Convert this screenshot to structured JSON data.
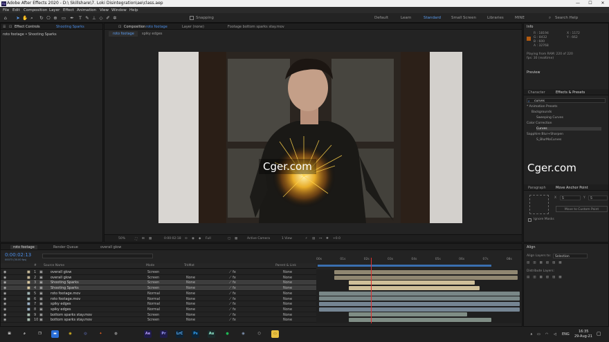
{
  "window": {
    "title": "Adobe After Effects 2020 - D:\\ Skillshare\\7. Loki Disintegration\\ae\\class.aep",
    "app_badge": "Ae",
    "minimize": "—",
    "maximize": "☐",
    "close": "✕"
  },
  "menu": [
    "File",
    "Edit",
    "Composition",
    "Layer",
    "Effect",
    "Animation",
    "View",
    "Window",
    "Help"
  ],
  "toolbar": {
    "snapping": "Snapping",
    "workspaces": [
      "Default",
      "Learn",
      "Standard",
      "Small Screen",
      "Libraries",
      "MINE"
    ],
    "active_workspace": "Standard",
    "search_help": "Search Help"
  },
  "effect_controls": {
    "tab": "Effect Controls",
    "tab_layer": "Shooting Sparks",
    "breadcrumb": "roto footage • Shooting Sparks"
  },
  "composition": {
    "tab": "Composition",
    "tab_comp": "roto footage",
    "layer_tab": "Layer  (none)",
    "footage_tab": "Footage  bottom sparks stay.mov",
    "view_tabs": [
      "roto footage",
      "spiky edges"
    ],
    "zoom": "50%",
    "timecode": "0:00:02:18",
    "resolution": "Full",
    "camera": "Active Camera",
    "views": "1 View",
    "exposure": "+0.0",
    "watermark": "Cger.com"
  },
  "info": {
    "title": "Info",
    "r": "R :  18194",
    "g": "G :  8432",
    "b": "B :  600",
    "a": "A :  32768",
    "x": "X :  1172",
    "y": "Y :  662",
    "playing": "Playing from RAM: 220 of 220",
    "fps": "fps: 30 (realtime)",
    "swatch": "#b25a10"
  },
  "preview": {
    "title": "Preview"
  },
  "effects": {
    "tab_character": "Character",
    "tab_effects": "Effects & Presets",
    "search": "curves",
    "tree": [
      {
        "label": "* Animation Presets",
        "indent": 0
      },
      {
        "label": "Backgrounds",
        "indent": 1
      },
      {
        "label": "Sweeping Curves",
        "indent": 2
      },
      {
        "label": "Color Correction",
        "indent": 0
      },
      {
        "label": "Curves",
        "indent": 2,
        "selected": true
      },
      {
        "label": "Sapphire Blur+Sharpen",
        "indent": 0
      },
      {
        "label": "S_BlurMoCurves",
        "indent": 2
      }
    ]
  },
  "paragraph": {
    "tab": "Paragraph",
    "tab_anchor": "Move Anchor Point",
    "x_label": "X",
    "x_value": "5",
    "y_label": "Y",
    "y_value": "5",
    "move_button": "Move to Custom Point",
    "ignore_masks": "Ignore Masks"
  },
  "align": {
    "title": "Align",
    "align_to_label": "Align Layers to:",
    "align_to_value": "Selection",
    "distribute": "Distribute Layers:"
  },
  "timeline": {
    "tabs": [
      "roto footage",
      "Render Queue",
      "overall glow"
    ],
    "timecode": "0:00:02:13",
    "frame_info": "00073 (30.00 fps)",
    "headers": {
      "num": "#",
      "name": "Source Name",
      "mode": "Mode",
      "trkmat": "TrkMat",
      "parent": "Parent & Link"
    },
    "ruler": [
      "00s",
      "01s",
      "02s",
      "03s",
      "04s",
      "05s",
      "06s",
      "07s",
      "08s"
    ],
    "playhead_seconds": 2.23,
    "duration_seconds": 8.5,
    "layers": [
      {
        "num": "1",
        "name": "overall glow",
        "mode": "Screen",
        "trkmat": "",
        "parent": "None",
        "color": "#c1b494",
        "start": 0.7,
        "end": 8.4,
        "sel": false
      },
      {
        "num": "2",
        "name": "overall glow",
        "mode": "Screen",
        "trkmat": "None",
        "parent": "None",
        "color": "#c1b494",
        "start": 0.7,
        "end": 8.4,
        "sel": false
      },
      {
        "num": "3",
        "name": "Shooting Sparks",
        "mode": "Screen",
        "trkmat": "None",
        "parent": "None",
        "color": "#d8c8a0",
        "start": 1.3,
        "end": 6.6,
        "sel": true
      },
      {
        "num": "4",
        "name": "Shooting Sparks",
        "mode": "Screen",
        "trkmat": "None",
        "parent": "None",
        "color": "#d8c8a0",
        "start": 1.3,
        "end": 6.8,
        "sel": true
      },
      {
        "num": "5",
        "name": "roto footage.mov",
        "mode": "Normal",
        "trkmat": "None",
        "parent": "None",
        "color": "#a0b4b4",
        "start": 0.05,
        "end": 8.5,
        "sel": false
      },
      {
        "num": "6",
        "name": "roto footage.mov",
        "mode": "Normal",
        "trkmat": "None",
        "parent": "None",
        "color": "#a0b4b4",
        "start": 0.05,
        "end": 8.5,
        "sel": false
      },
      {
        "num": "7",
        "name": "spiky edges",
        "mode": "Normal",
        "trkmat": "None",
        "parent": "None",
        "color": "#9ab0c4",
        "start": 0.05,
        "end": 8.5,
        "sel": false
      },
      {
        "num": "8",
        "name": "spiky edges",
        "mode": "Normal",
        "trkmat": "None",
        "parent": "None",
        "color": "#9ab0c4",
        "start": 0.05,
        "end": 8.5,
        "sel": false
      },
      {
        "num": "9",
        "name": "bottom sparks stay.mov",
        "mode": "Screen",
        "trkmat": "None",
        "parent": "None",
        "color": "#a8bcb0",
        "start": 1.3,
        "end": 6.3,
        "sel": false
      },
      {
        "num": "10",
        "name": "bottom sparks stay.mov",
        "mode": "Screen",
        "trkmat": "None",
        "parent": "None",
        "color": "#a8bcb0",
        "start": 1.3,
        "end": 7.3,
        "sel": false
      }
    ]
  },
  "taskbar": {
    "lang": "ENG",
    "time": "16:35",
    "date": "29-Aug-21",
    "icons": [
      {
        "name": "windows-icon",
        "glyph": "⊞",
        "bg": "transparent",
        "fg": "#ffffff"
      },
      {
        "name": "search-icon",
        "glyph": "⌕",
        "bg": "transparent",
        "fg": "#ffffff"
      },
      {
        "name": "task-view-icon",
        "glyph": "❐",
        "bg": "transparent",
        "fg": "#ffffff"
      },
      {
        "name": "file-explorer-icon",
        "glyph": "▬",
        "bg": "#2b6fd8",
        "fg": "#ffffff"
      },
      {
        "name": "chrome-icon",
        "glyph": "◉",
        "bg": "transparent",
        "fg": "#e8c020"
      },
      {
        "name": "browser-icon",
        "glyph": "◎",
        "bg": "transparent",
        "fg": "#6a7fd8"
      },
      {
        "name": "app-icon",
        "glyph": "✦",
        "bg": "transparent",
        "fg": "#e86020"
      },
      {
        "name": "media-icon",
        "glyph": "◍",
        "bg": "transparent",
        "fg": "#d0d0d0"
      },
      {
        "name": "after-effects-icon",
        "glyph": "Ae",
        "bg": "#1f1b4a",
        "fg": "#b79cff"
      },
      {
        "name": "premiere-icon",
        "glyph": "Pr",
        "bg": "#1f1b4a",
        "fg": "#9f9fff"
      },
      {
        "name": "lightroom-icon",
        "glyph": "LrC",
        "bg": "#0d2437",
        "fg": "#5fb5ff"
      },
      {
        "name": "photoshop-icon",
        "glyph": "Ps",
        "bg": "#0d2437",
        "fg": "#31a8ff"
      },
      {
        "name": "audition-icon",
        "glyph": "Au",
        "bg": "#1b2b2b",
        "fg": "#9fffdf"
      },
      {
        "name": "spotify-icon",
        "glyph": "●",
        "bg": "transparent",
        "fg": "#1db954"
      },
      {
        "name": "steam-icon",
        "glyph": "◉",
        "bg": "transparent",
        "fg": "#8aa0c0"
      },
      {
        "name": "settings-icon",
        "glyph": "⬡",
        "bg": "transparent",
        "fg": "#d0d0d0"
      },
      {
        "name": "folder-icon",
        "glyph": "▭",
        "bg": "#e8c040",
        "fg": "#6a4c00"
      }
    ]
  }
}
